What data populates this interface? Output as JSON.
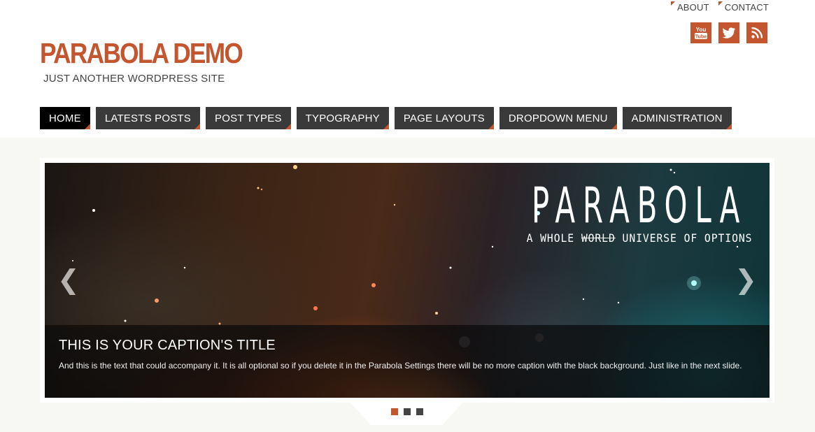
{
  "top_links": [
    "ABOUT",
    "CONTACT"
  ],
  "social": [
    {
      "name": "youtube-icon",
      "label": "You Tube"
    },
    {
      "name": "twitter-icon",
      "label": ""
    },
    {
      "name": "rss-icon",
      "label": ""
    }
  ],
  "site": {
    "title": "PARABOLA DEMO",
    "tagline": "JUST ANOTHER WORDPRESS SITE"
  },
  "nav": [
    {
      "label": "HOME",
      "active": true
    },
    {
      "label": "LATESTS POSTS",
      "active": false
    },
    {
      "label": "POST TYPES",
      "active": false
    },
    {
      "label": "TYPOGRAPHY",
      "active": false
    },
    {
      "label": "PAGE LAYOUTS",
      "active": false
    },
    {
      "label": "DROPDOWN MENU",
      "active": false
    },
    {
      "label": "ADMINISTRATION",
      "active": false
    }
  ],
  "slider": {
    "brand_title": "PARABOLA",
    "brand_sub_before": "A WHOLE",
    "brand_sub_strike": "WORLD",
    "brand_sub_after": "UNIVERSE OF OPTIONS",
    "prev_glyph": "❮",
    "next_glyph": "❯",
    "caption_title": "THIS IS YOUR CAPTION'S TITLE",
    "caption_text": "And this is the text that could accompany it. It is all optional so if you delete it in the Parabola Settings there will be no more caption with the black background. Just like in the next slide.",
    "slide_count": 3,
    "active_slide": 0
  },
  "colors": {
    "accent": "#c3552f",
    "nav_bg": "#3a3a3a",
    "nav_active_bg": "#000000"
  }
}
